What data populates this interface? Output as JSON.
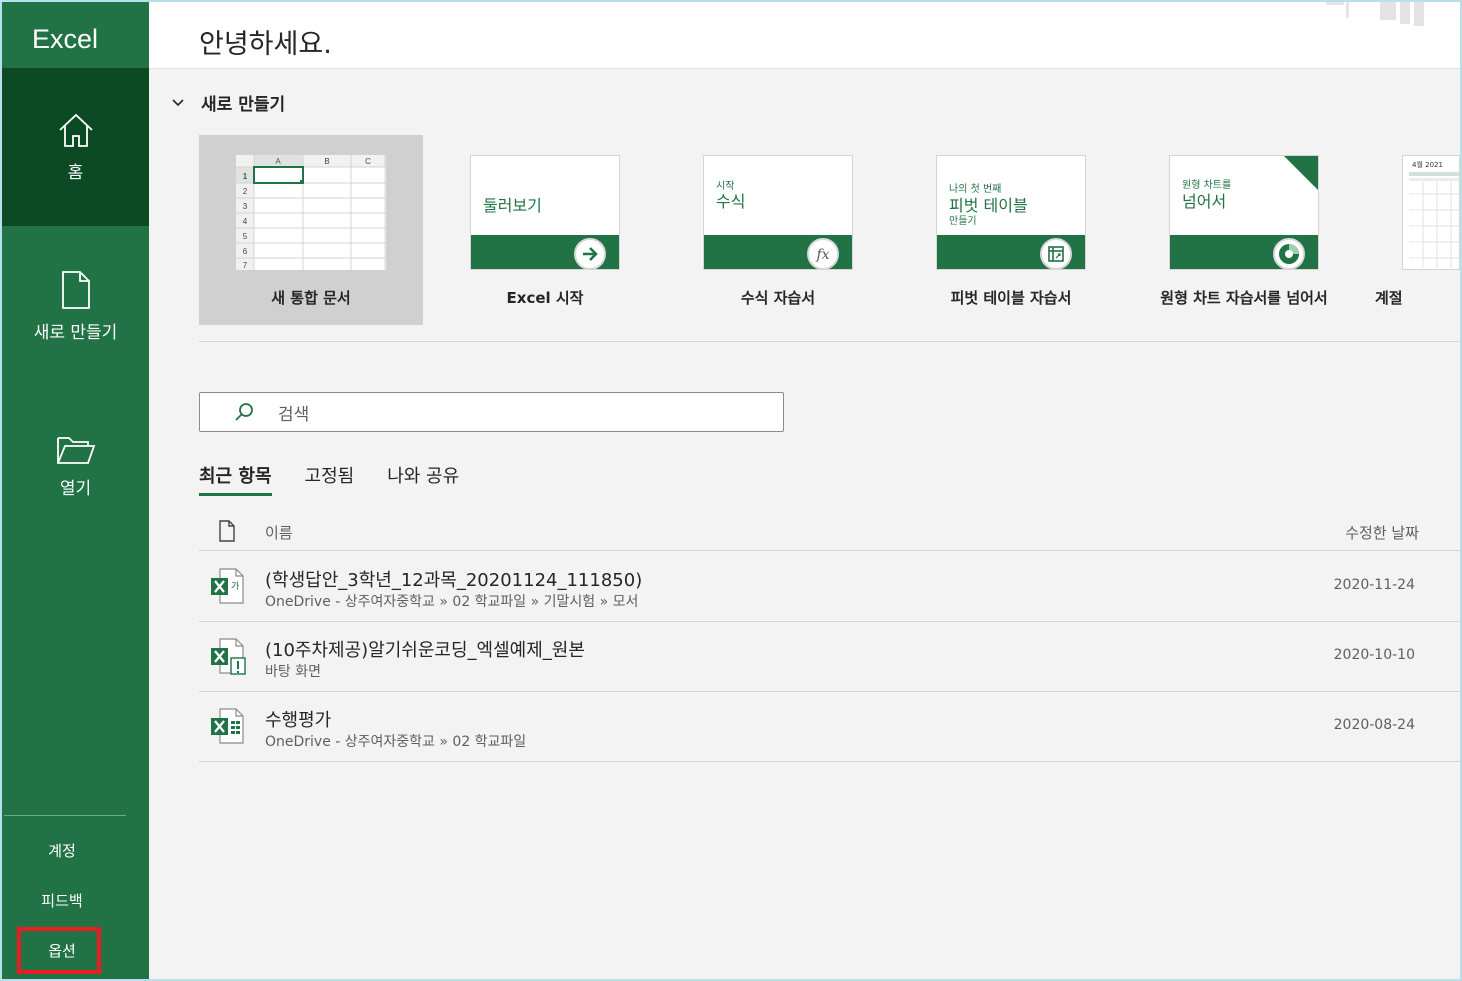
{
  "app": {
    "title": "Excel"
  },
  "header": {
    "greeting": "안녕하세요."
  },
  "sidebar": {
    "items": [
      {
        "label": "홈",
        "icon": "home-icon"
      },
      {
        "label": "새로 만들기",
        "icon": "new-document-icon"
      },
      {
        "label": "열기",
        "icon": "folder-open-icon"
      }
    ],
    "bottom": [
      {
        "label": "계정"
      },
      {
        "label": "피드백"
      },
      {
        "label": "옵션"
      }
    ]
  },
  "new_section": {
    "title": "새로 만들기",
    "templates": [
      {
        "label": "새 통합 문서",
        "grid_cols": [
          "A",
          "B",
          "C"
        ],
        "grid_rows": [
          "1",
          "2",
          "3",
          "4",
          "5",
          "6",
          "7"
        ]
      },
      {
        "label": "Excel 시작",
        "thumb_big": "둘러보기",
        "icon": "arrow-right-icon"
      },
      {
        "label": "수식 자습서",
        "thumb_small": "시작",
        "thumb_big": "수식",
        "icon": "fx-icon"
      },
      {
        "label": "피벗 테이블 자습서",
        "thumb_small": "나의 첫 번째",
        "thumb_big": "피벗 테이블",
        "thumb_small2": "만들기",
        "icon": "pivot-table-icon"
      },
      {
        "label": "원형 차트 자습서를 넘어서",
        "thumb_small": "원형 차트를",
        "thumb_big": "넘어서",
        "icon": "pie-chart-icon"
      },
      {
        "label": "계절",
        "thumb_small": "4월 2021"
      }
    ]
  },
  "search": {
    "placeholder": "검색"
  },
  "tabs": [
    {
      "label": "최근 항목"
    },
    {
      "label": "고정됨"
    },
    {
      "label": "나와 공유"
    }
  ],
  "file_list": {
    "columns": {
      "name": "이름",
      "date": "수정한 날짜"
    },
    "rows": [
      {
        "name": "(학생답안_3학년_12과목_20201124_111850)",
        "path": "OneDrive - 상주여자중학교 » 02 학교파일 » 기말시험 » 모서",
        "date": "2020-11-24",
        "icon": "excel-file-icon"
      },
      {
        "name": "(10주차제공)알기쉬운코딩_엑셀예제_원본",
        "path": "바탕 화면",
        "date": "2020-10-10",
        "icon": "excel-file-warning-icon"
      },
      {
        "name": "수행평가",
        "path": "OneDrive - 상주여자중학교 » 02 학교파일",
        "date": "2020-08-24",
        "icon": "excel-file-icon"
      }
    ]
  },
  "colors": {
    "brand": "#217346",
    "brand_dark": "#0b4a23",
    "highlight": "#e81c23"
  }
}
